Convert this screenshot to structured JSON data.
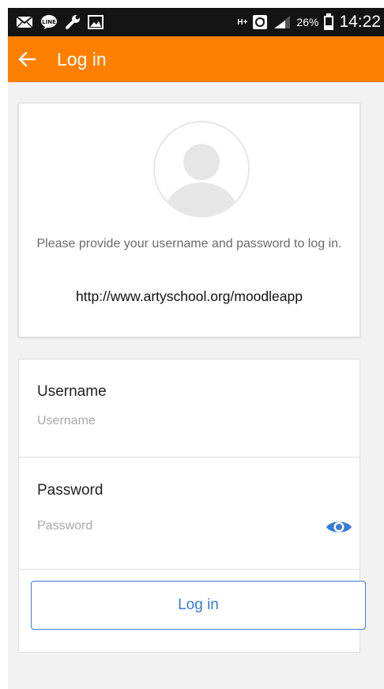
{
  "status_bar": {
    "icons": [
      "mail-icon",
      "line-chat-icon",
      "wrench-icon",
      "image-icon",
      "h-plus-network-icon",
      "sync-icon",
      "signal-icon",
      "battery-icon"
    ],
    "network": "H+",
    "battery": "26%",
    "time": "14:22"
  },
  "toolbar": {
    "back_icon": "arrow-left-icon",
    "title": "Log in",
    "color": "#ff7f00"
  },
  "site_info": {
    "avatar_icon": "default-user-avatar-icon",
    "description": "Please provide your username and password to log in.",
    "url": "http://www.artyschool.org/moodleapp"
  },
  "form": {
    "username": {
      "label": "Username",
      "placeholder": "Username",
      "value": ""
    },
    "password": {
      "label": "Password",
      "placeholder": "Password",
      "value": "",
      "toggle_icon": "eye-icon"
    },
    "submit_label": "Log in",
    "accent": "#3a7bd5"
  }
}
